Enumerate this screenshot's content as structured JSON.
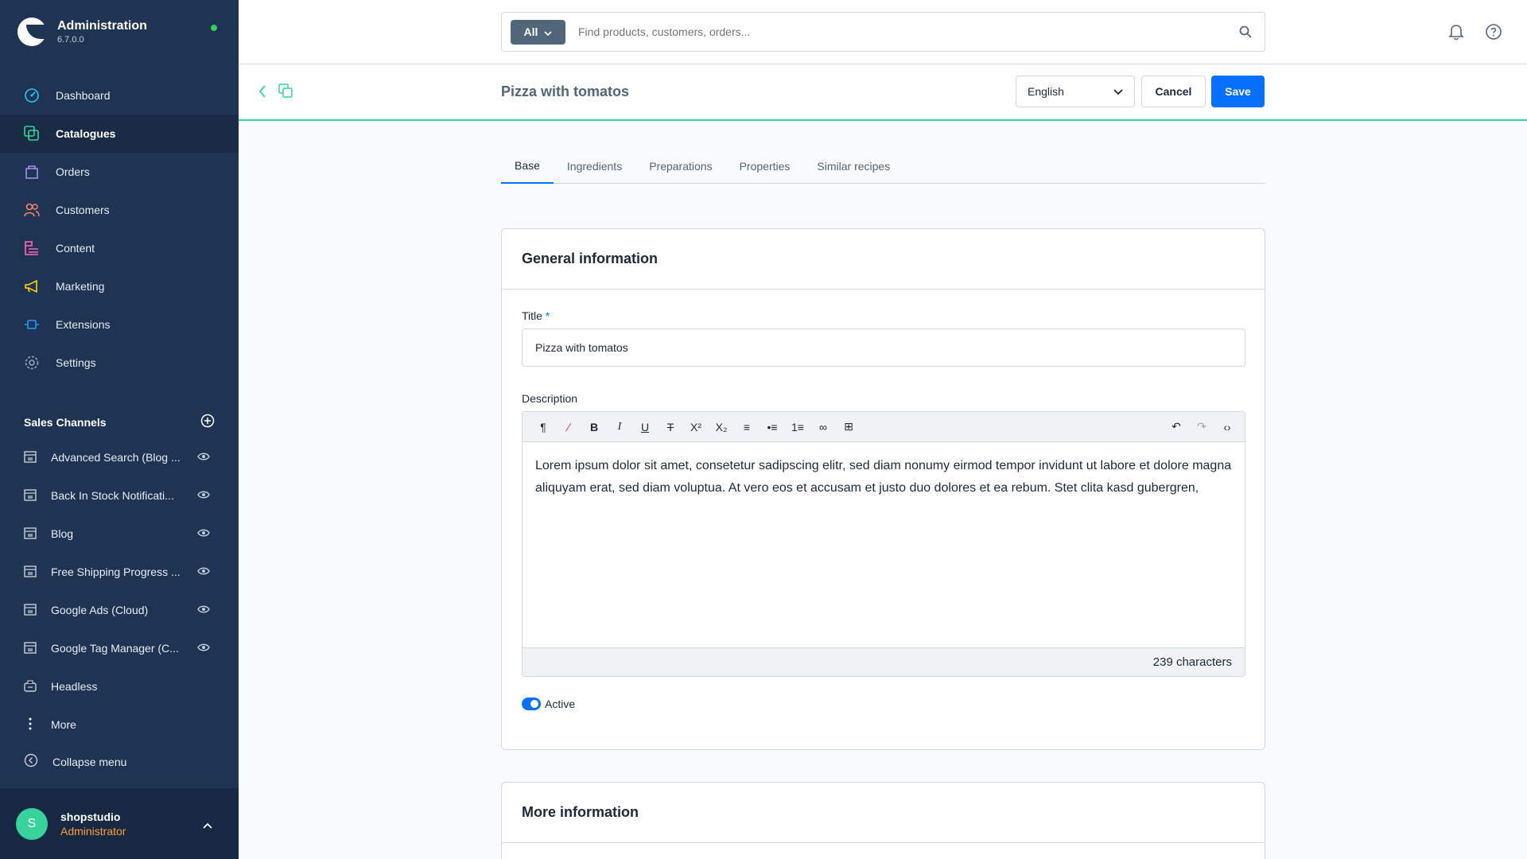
{
  "brand": {
    "title": "Administration",
    "version": "6.7.0.0"
  },
  "nav": [
    {
      "label": "Dashboard",
      "icon": "dashboard-icon",
      "color": "#26c6f9"
    },
    {
      "label": "Catalogues",
      "icon": "catalogue-icon",
      "color": "#37d39a",
      "active": true
    },
    {
      "label": "Orders",
      "icon": "orders-icon",
      "color": "#a092f0"
    },
    {
      "label": "Customers",
      "icon": "customers-icon",
      "color": "#f88962"
    },
    {
      "label": "Content",
      "icon": "content-icon",
      "color": "#ff68b4"
    },
    {
      "label": "Marketing",
      "icon": "marketing-icon",
      "color": "#ffd700"
    },
    {
      "label": "Extensions",
      "icon": "extensions-icon",
      "color": "#189eff"
    },
    {
      "label": "Settings",
      "icon": "settings-icon",
      "color": "#9aa8b5"
    }
  ],
  "sales_channels": {
    "heading": "Sales Channels",
    "items": [
      "Advanced Search (Blog ...",
      "Back In Stock Notificati...",
      "Blog",
      "Free Shipping Progress ...",
      "Google Ads (Cloud)",
      "Google Tag Manager (C...",
      "Headless",
      "More"
    ]
  },
  "collapse_label": "Collapse menu",
  "user": {
    "initial": "S",
    "name": "shopstudio",
    "role": "Administrator"
  },
  "search": {
    "filter": "All",
    "placeholder": "Find products, customers, orders..."
  },
  "smartbar": {
    "title": "Pizza with tomatos",
    "language": "English",
    "cancel": "Cancel",
    "save": "Save"
  },
  "tabs": [
    "Base",
    "Ingredients",
    "Preparations",
    "Properties",
    "Similar recipes"
  ],
  "general": {
    "heading": "General information",
    "title_label": "Title",
    "title_required": "*",
    "title_value": "Pizza with tomatos",
    "description_label": "Description",
    "description_text": "Lorem ipsum dolor sit amet, consetetur sadipscing elitr, sed diam nonumy eirmod tempor invidunt ut labore et dolore magna aliquyam erat, sed diam voluptua. At vero eos et accusam et justo duo dolores et ea rebum. Stet clita kasd gubergren,",
    "char_count": "239 characters",
    "active_label": "Active"
  },
  "more": {
    "heading": "More information"
  },
  "colors": {
    "sidebar": "#1f3352",
    "accent": "#0870ff",
    "success": "#37d39a",
    "role": "#ff9d3a"
  }
}
